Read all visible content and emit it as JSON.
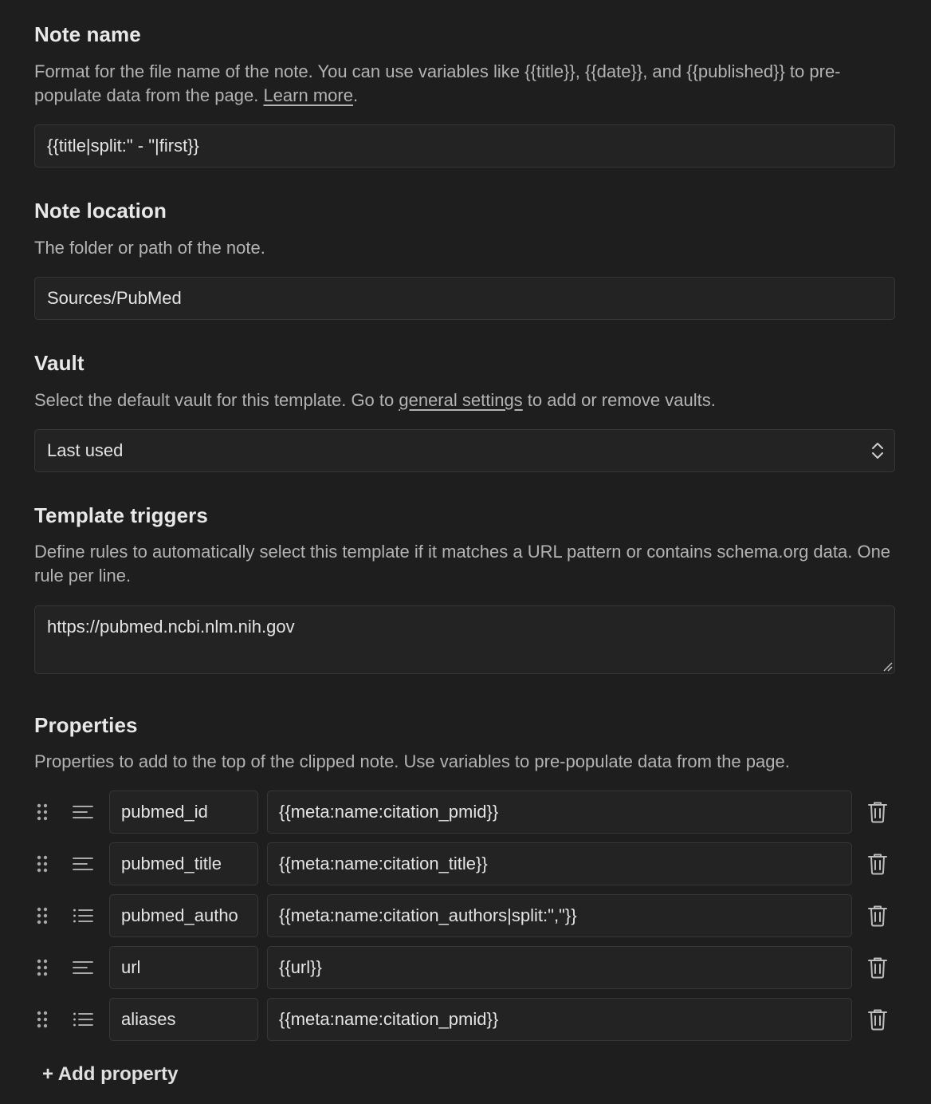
{
  "note_name": {
    "title": "Note name",
    "desc_before": "Format for the file name of the note. You can use variables like {{title}}, {{date}}, and {{published}} to pre-populate data from the page. ",
    "desc_link": "Learn more",
    "desc_after": ".",
    "value": "{{title|split:\" - \"|first}}"
  },
  "note_location": {
    "title": "Note location",
    "desc": "The folder or path of the note.",
    "value": "Sources/PubMed"
  },
  "vault": {
    "title": "Vault",
    "desc_before": "Select the default vault for this template. Go to ",
    "desc_link": "general settings",
    "desc_after": " to add or remove vaults.",
    "selected": "Last used"
  },
  "triggers": {
    "title": "Template triggers",
    "desc": "Define rules to automatically select this template if it matches a URL pattern or contains schema.org data. One rule per line.",
    "value": "https://pubmed.ncbi.nlm.nih.gov"
  },
  "properties": {
    "title": "Properties",
    "desc": "Properties to add to the top of the clipped note. Use variables to pre-populate data from the page.",
    "items": [
      {
        "type_icon": "text-icon",
        "name": "pubmed_id",
        "value": "{{meta:name:citation_pmid}}"
      },
      {
        "type_icon": "text-icon",
        "name": "pubmed_title",
        "value": "{{meta:name:citation_title}}"
      },
      {
        "type_icon": "list-icon",
        "name": "pubmed_autho",
        "value": "{{meta:name:citation_authors|split:\",\"}}"
      },
      {
        "type_icon": "text-icon",
        "name": "url",
        "value": "{{url}}"
      },
      {
        "type_icon": "list-icon",
        "name": "aliases",
        "value": "{{meta:name:citation_pmid}}"
      }
    ],
    "add_label": "+ Add property"
  }
}
